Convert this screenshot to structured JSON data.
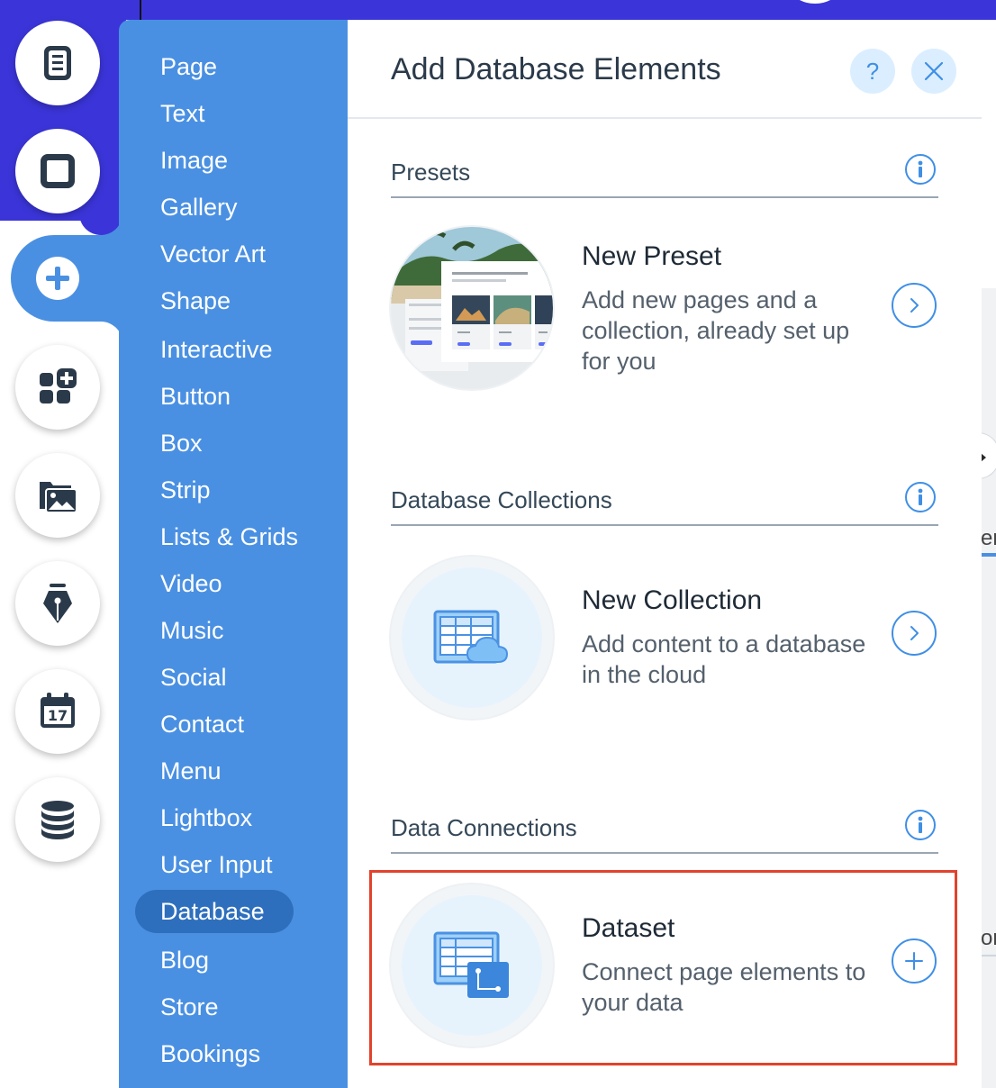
{
  "toolbar": {
    "buttons": [
      {
        "icon": "pages-icon"
      },
      {
        "icon": "background-icon"
      },
      {
        "icon": "add-icon"
      },
      {
        "icon": "add-apps-icon"
      },
      {
        "icon": "media-icon"
      },
      {
        "icon": "pen-icon"
      },
      {
        "icon": "calendar-icon",
        "badge": "17"
      },
      {
        "icon": "database-icon"
      }
    ]
  },
  "categories": {
    "items": [
      "Page",
      "Text",
      "Image",
      "Gallery",
      "Vector Art",
      "Shape",
      "Interactive",
      "Button",
      "Box",
      "Strip",
      "Lists & Grids",
      "Video",
      "Music",
      "Social",
      "Contact",
      "Menu",
      "Lightbox",
      "User Input",
      "Database",
      "Blog",
      "Store",
      "Bookings"
    ],
    "selected": "Database"
  },
  "panel": {
    "title": "Add Database Elements",
    "help_label": "?",
    "sections": [
      {
        "title": "Presets",
        "item": {
          "title": "New Preset",
          "description": "Add new pages and a collection, already set up for you",
          "action": "chevron-right-icon"
        }
      },
      {
        "title": "Database Collections",
        "item": {
          "title": "New Collection",
          "description": "Add content to a database in the cloud",
          "action": "chevron-right-icon"
        }
      },
      {
        "title": "Data Connections",
        "item": {
          "title": "Dataset",
          "description": "Connect page elements to your data",
          "action": "plus-icon"
        }
      }
    ]
  },
  "background": {
    "right_fragment_1": "er",
    "right_fragment_2": "or"
  },
  "colors": {
    "canvas_blue": "#3b35d9",
    "menu_blue": "#4a90e2",
    "menu_selected": "#2e6fbd",
    "accent": "#3f8fe6",
    "highlight": "#e2422c"
  }
}
